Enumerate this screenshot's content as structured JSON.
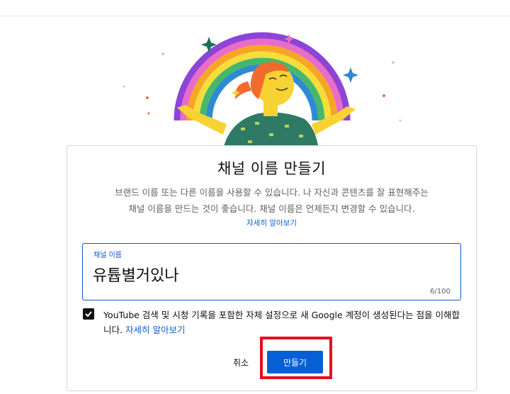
{
  "dialog": {
    "title": "채널 이름 만들기",
    "description_line1": "브랜드 이름 또는 다른 이름을 사용할 수 있습니다. 나 자신과 콘텐츠를 잘 표현해주는",
    "description_line2": "채널 이름을 만드는 것이 좋습니다. 채널 이름은 언제든지 변경할 수 있습니다.",
    "learn_more": "자세히 알아보기",
    "field": {
      "label": "채널 이름",
      "value": "유튭별거있나",
      "counter": "6/100"
    },
    "consent": {
      "checked": true,
      "text": "YouTube 검색 및 시청 기록을 포함한 자체 설정으로 새 Google 계정이 생성된다는 점을 이해합니다.",
      "link": "자세히 알아보기"
    },
    "cancel_label": "취소",
    "create_label": "만들기"
  },
  "colors": {
    "accent": "#065fd4",
    "highlight_box": "#e3101d",
    "rainbow": [
      "#8e44d6",
      "#e96cc7",
      "#f5a623",
      "#f7dd3b",
      "#46b86b",
      "#2e8bd1"
    ]
  }
}
